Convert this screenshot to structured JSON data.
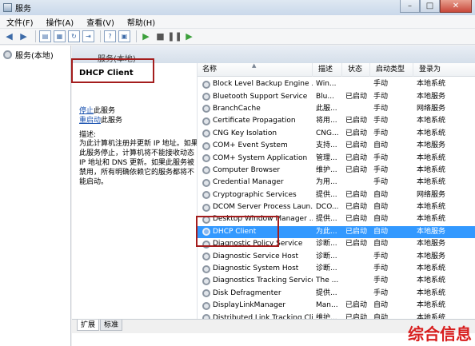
{
  "window": {
    "title": "服务"
  },
  "menu": [
    "文件(F)",
    "操作(A)",
    "查看(V)",
    "帮助(H)"
  ],
  "tree": {
    "item": "服务(本地)"
  },
  "main_header": {
    "title": "服务(本地)"
  },
  "details": {
    "service_title": "DHCP Client",
    "stop_link": "停止",
    "stop_suffix": "此服务",
    "restart_link": "重启动",
    "restart_suffix": "此服务",
    "desc_label": "描述:",
    "desc_text": "为此计算机注册并更新 IP 地址。如果此服务停止，计算机将不能接收动态 IP 地址和 DNS 更新。如果此服务被禁用，所有明确依赖它的服务都将不能启动。"
  },
  "list": {
    "columns": [
      "名称",
      "描述",
      "状态",
      "启动类型",
      "登录为"
    ],
    "rows": [
      {
        "name": "Block Level Backup Engine ...",
        "desc": "Win...",
        "status": "",
        "startup": "手动",
        "logon": "本地系统",
        "selected": false
      },
      {
        "name": "Bluetooth Support Service",
        "desc": "Blu...",
        "status": "已启动",
        "startup": "手动",
        "logon": "本地服务",
        "selected": false
      },
      {
        "name": "BranchCache",
        "desc": "此服...",
        "status": "",
        "startup": "手动",
        "logon": "网络服务",
        "selected": false
      },
      {
        "name": "Certificate Propagation",
        "desc": "将用...",
        "status": "已启动",
        "startup": "手动",
        "logon": "本地系统",
        "selected": false
      },
      {
        "name": "CNG Key Isolation",
        "desc": "CNG...",
        "status": "已启动",
        "startup": "手动",
        "logon": "本地系统",
        "selected": false
      },
      {
        "name": "COM+ Event System",
        "desc": "支持...",
        "status": "已启动",
        "startup": "自动",
        "logon": "本地服务",
        "selected": false
      },
      {
        "name": "COM+ System Application",
        "desc": "管理...",
        "status": "已启动",
        "startup": "手动",
        "logon": "本地系统",
        "selected": false
      },
      {
        "name": "Computer Browser",
        "desc": "维护...",
        "status": "已启动",
        "startup": "手动",
        "logon": "本地系统",
        "selected": false
      },
      {
        "name": "Credential Manager",
        "desc": "为用...",
        "status": "",
        "startup": "手动",
        "logon": "本地系统",
        "selected": false
      },
      {
        "name": "Cryptographic Services",
        "desc": "提供...",
        "status": "已启动",
        "startup": "自动",
        "logon": "网络服务",
        "selected": false
      },
      {
        "name": "DCOM Server Process Laun...",
        "desc": "DCO...",
        "status": "已启动",
        "startup": "自动",
        "logon": "本地系统",
        "selected": false
      },
      {
        "name": "Desktop Window Manager ...",
        "desc": "提供...",
        "status": "已启动",
        "startup": "自动",
        "logon": "本地系统",
        "selected": false
      },
      {
        "name": "DHCP Client",
        "desc": "为此...",
        "status": "已启动",
        "startup": "自动",
        "logon": "本地服务",
        "selected": true
      },
      {
        "name": "Diagnostic Policy Service",
        "desc": "诊断...",
        "status": "已启动",
        "startup": "自动",
        "logon": "本地服务",
        "selected": false
      },
      {
        "name": "Diagnostic Service Host",
        "desc": "诊断...",
        "status": "",
        "startup": "手动",
        "logon": "本地服务",
        "selected": false
      },
      {
        "name": "Diagnostic System Host",
        "desc": "诊断...",
        "status": "",
        "startup": "手动",
        "logon": "本地系统",
        "selected": false
      },
      {
        "name": "Diagnostics Tracking Service",
        "desc": "The ...",
        "status": "",
        "startup": "手动",
        "logon": "本地系统",
        "selected": false
      },
      {
        "name": "Disk Defragmenter",
        "desc": "提供...",
        "status": "",
        "startup": "手动",
        "logon": "本地系统",
        "selected": false
      },
      {
        "name": "DisplayLinkManager",
        "desc": "Man...",
        "status": "已启动",
        "startup": "自动",
        "logon": "本地系统",
        "selected": false
      },
      {
        "name": "Distributed Link Tracking Cli...",
        "desc": "维护...",
        "status": "已启动",
        "startup": "自动",
        "logon": "本地系统",
        "selected": false
      }
    ]
  },
  "tabs": [
    "扩展",
    "标准"
  ],
  "watermark": "综合信息",
  "colors": {
    "selection": "#3399ff",
    "highlight_box": "#a41d1d",
    "watermark": "#d81e1e"
  }
}
